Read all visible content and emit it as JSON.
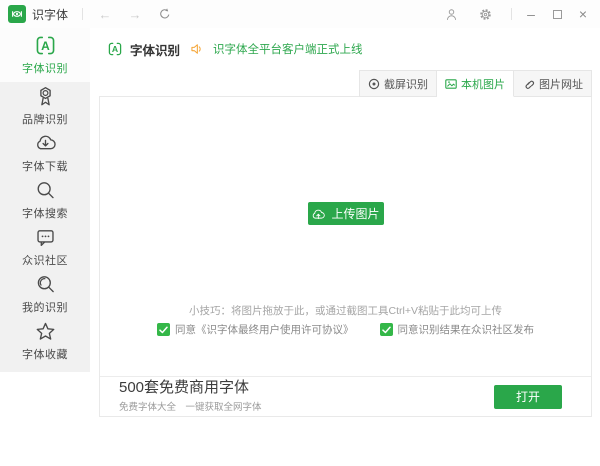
{
  "titlebar": {
    "app_title": "识字体",
    "icons": {
      "back": "←",
      "forward": "→",
      "minimize": "–",
      "close": "×"
    }
  },
  "sidebar": {
    "items": [
      {
        "label": "字体识别",
        "icon": "font-recognition-icon",
        "active": true
      },
      {
        "label": "品牌识别",
        "icon": "brand-recognition-icon",
        "active": false
      },
      {
        "label": "字体下载",
        "icon": "font-download-icon",
        "active": false
      },
      {
        "label": "字体搜索",
        "icon": "font-search-icon",
        "active": false
      },
      {
        "label": "众识社区",
        "icon": "community-icon",
        "active": false
      },
      {
        "label": "我的识别",
        "icon": "my-recognition-icon",
        "active": false
      },
      {
        "label": "字体收藏",
        "icon": "font-favorites-icon",
        "active": false
      }
    ]
  },
  "header": {
    "title": "字体识别",
    "announcement": "识字体全平台客户端正式上线",
    "announcement_icon": "speaker-icon"
  },
  "tabs": [
    {
      "label": "截屏识别",
      "icon": "screen-capture-icon",
      "active": false
    },
    {
      "label": "本机图片",
      "icon": "local-image-icon",
      "active": true
    },
    {
      "label": "图片网址",
      "icon": "image-url-icon",
      "active": false
    }
  ],
  "upload_panel": {
    "upload_button": "上传图片",
    "upload_button_icon": "cloud-upload-icon",
    "tip": "小技巧：将图片拖放于此，或通过截图工具Ctrl+V粘贴于此均可上传",
    "agreements": [
      {
        "label": "同意《识字体最终用户使用许可协议》",
        "checked": true
      },
      {
        "label": "同意识别结果在众识社区发布",
        "checked": true
      }
    ]
  },
  "banner": {
    "title": "500套免费商用字体",
    "subtitle": "免费字体大全　一键获取全网字体",
    "open_button": "打开"
  },
  "colors": {
    "accent_green": "#2aa74a",
    "checkbox_green": "#34b748",
    "announcement_green": "#2fa84f",
    "speaker_orange": "#f5a638"
  }
}
